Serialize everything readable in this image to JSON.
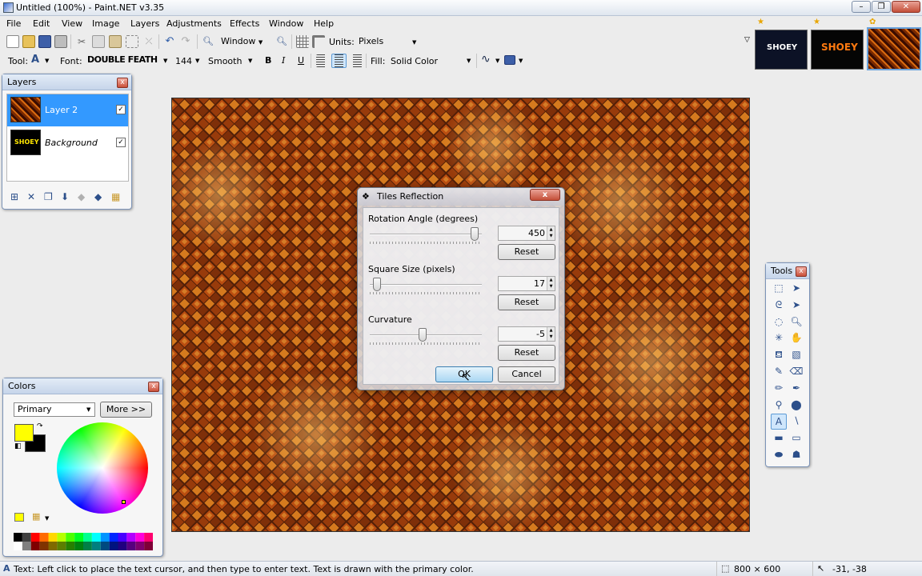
{
  "window": {
    "title": "Untitled (100%) - Paint.NET v3.35"
  },
  "menu": [
    "File",
    "Edit",
    "View",
    "Image",
    "Layers",
    "Adjustments",
    "Effects",
    "Window",
    "Help"
  ],
  "toolbar": {
    "zoom_label": "Window",
    "units_label": "Units:",
    "units_value": "Pixels"
  },
  "text_toolbar": {
    "tool_label": "Tool:",
    "tool_glyph": "A",
    "font_label": "Font:",
    "font_value": "DOUBLE FEATH",
    "size_value": "144",
    "antialias_value": "Smooth",
    "bold": "B",
    "italic": "I",
    "underline": "U",
    "fill_label": "Fill:",
    "fill_value": "Solid Color"
  },
  "thumbnails": [
    {
      "label": "SHOEY",
      "active": false
    },
    {
      "label": "SHOEY",
      "active": false
    },
    {
      "label": "",
      "active": true
    }
  ],
  "layers_panel": {
    "title": "Layers",
    "close": "x",
    "layers": [
      {
        "name": "Layer 2",
        "thumb_label": "",
        "visible": true,
        "selected": true
      },
      {
        "name": "Background",
        "thumb_label": "SHOEY",
        "visible": true,
        "selected": false
      }
    ]
  },
  "colors_panel": {
    "title": "Colors",
    "close": "x",
    "mode": "Primary",
    "more_button": "More >>",
    "primary_color": "#ffff00",
    "secondary_color": "#000000",
    "palette": [
      "#000000",
      "#404040",
      "#ff0000",
      "#ff6a00",
      "#ffd800",
      "#b6ff00",
      "#4cff00",
      "#00ff21",
      "#00ff90",
      "#00ffff",
      "#0094ff",
      "#0026ff",
      "#4800ff",
      "#b200ff",
      "#ff00dc",
      "#ff006e",
      "#ffffff",
      "#808080",
      "#7f0000",
      "#7f3300",
      "#7f6a00",
      "#5b7f00",
      "#267f00",
      "#007f0e",
      "#007f46",
      "#007f7f",
      "#004a7f",
      "#00137f",
      "#21007f",
      "#57007f",
      "#7f006e",
      "#7f0037"
    ]
  },
  "dialog": {
    "title": "Tiles Reflection",
    "close": "x",
    "rotation": {
      "label": "Rotation Angle (degrees)",
      "value": "450",
      "reset": "Reset",
      "fraction": 0.97
    },
    "square": {
      "label": "Square Size (pixels)",
      "value": "17",
      "reset": "Reset",
      "fraction": 0.03
    },
    "curvature": {
      "label": "Curvature",
      "value": "-5",
      "reset": "Reset",
      "fraction": 0.47
    },
    "ok": "OK",
    "cancel": "Cancel"
  },
  "tools_panel": {
    "title": "Tools",
    "close": "x",
    "tools": [
      "rectangle-select-icon",
      "move-selection-icon",
      "lasso-select-icon",
      "move-selected-pixels-icon",
      "ellipse-select-icon",
      "zoom-icon",
      "magic-wand-icon",
      "pan-icon",
      "paint-bucket-icon",
      "gradient-icon",
      "paintbrush-icon",
      "eraser-icon",
      "pencil-icon",
      "color-picker-icon",
      "clone-stamp-icon",
      "recolor-icon",
      "text-icon",
      "line-curve-icon",
      "rectangle-icon",
      "rounded-rectangle-icon",
      "ellipse-icon",
      "freeform-shape-icon"
    ],
    "selected": "text-icon"
  },
  "status": {
    "message": "Text: Left click to place the text cursor, and then type to enter text. Text is drawn with the primary color.",
    "image_size": "800 × 600",
    "cursor": "-31, -38"
  }
}
